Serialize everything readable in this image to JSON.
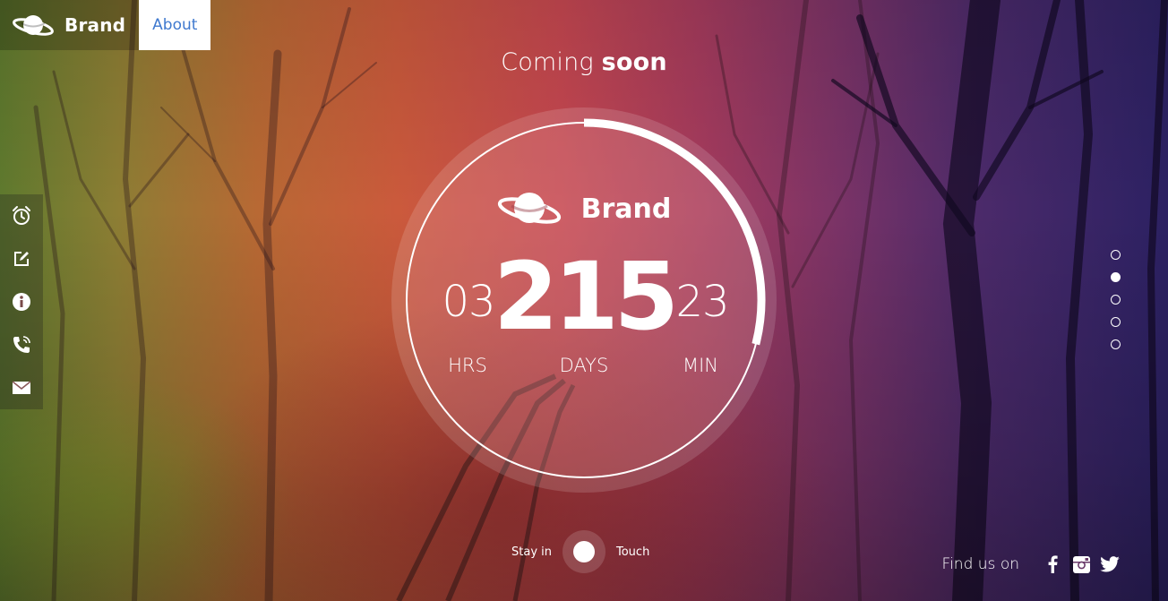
{
  "nav": {
    "brand": "Brand",
    "about": "About"
  },
  "headline": {
    "light": "Coming",
    "bold": "soon"
  },
  "side_menu": {
    "items": [
      {
        "icon": "alarm-clock-icon"
      },
      {
        "icon": "edit-icon"
      },
      {
        "icon": "info-icon"
      },
      {
        "icon": "phone-icon"
      },
      {
        "icon": "envelope-icon"
      }
    ]
  },
  "countdown": {
    "brand": "Brand",
    "hours": "03",
    "days": "215",
    "minutes": "23",
    "hours_label": "HRS",
    "days_label": "DAYS",
    "minutes_label": "MIN",
    "progress_fraction": 0.29
  },
  "pager": {
    "count": 5,
    "active_index": 1
  },
  "toggle": {
    "left_label": "Stay in",
    "right_label": "Touch"
  },
  "footer": {
    "find_us": "Find us on",
    "social": [
      "facebook-icon",
      "instagram-icon",
      "twitter-icon"
    ]
  },
  "colors": {
    "accent": "#3f79cf",
    "text": "#ffffff"
  }
}
